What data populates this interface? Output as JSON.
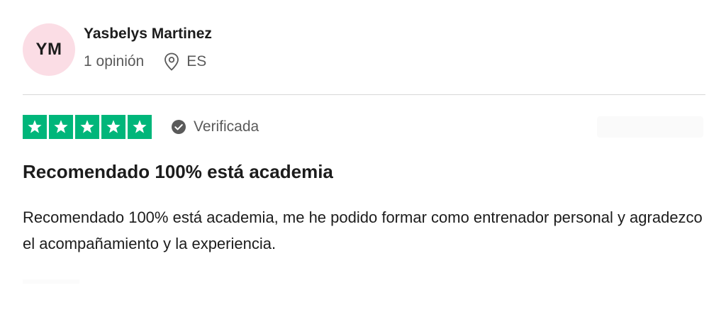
{
  "reviewer": {
    "initials": "YM",
    "name": "Yasbelys Martinez",
    "reviews_count": "1 opinión",
    "country": "ES",
    "avatar_color": "#fbdde5"
  },
  "rating": {
    "stars": 5,
    "max": 5,
    "color": "#00b67a",
    "icon": "star-icon"
  },
  "verification": {
    "label": "Verificada",
    "icon": "verified-check-icon"
  },
  "review": {
    "title": "Recomendado 100% está academia",
    "body": "Recomendado 100% está academia, me he podido formar como entrenador personal y agradezco el acompañamiento y la experiencia."
  }
}
